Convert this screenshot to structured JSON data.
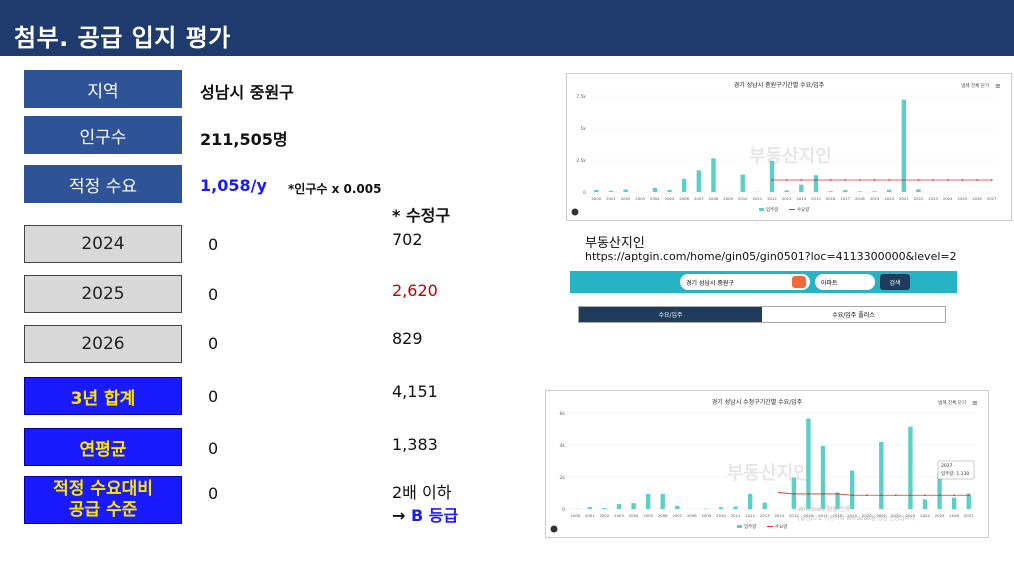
{
  "title": "첨부. 공급 입지 평가",
  "rows": {
    "region": {
      "label": "지역",
      "value": "성남시 중원구"
    },
    "population": {
      "label": "인구수",
      "value": "211,505명"
    },
    "demand": {
      "label": "적정 수요",
      "value": "1,058/y",
      "note": "*인구수 x 0.005"
    },
    "y2024": {
      "label": "2024",
      "value": "0",
      "compare": "702"
    },
    "y2025": {
      "label": "2025",
      "value": "0",
      "compare": "2,620"
    },
    "y2026": {
      "label": "2026",
      "value": "0",
      "compare": "829"
    },
    "total": {
      "label": "3년 합계",
      "value": "0",
      "compare": "4,151"
    },
    "avg": {
      "label": "연평균",
      "value": "0",
      "compare": "1,383"
    },
    "level": {
      "label_line1": "적정 수요대비",
      "label_line2": "공급 수준",
      "value": "0",
      "compare_line1": "2배 이하",
      "compare_line2_prefix": "→ ",
      "compare_line2_grade": "B 등급"
    }
  },
  "compare_header": "* 수정구",
  "source": {
    "name": "부동산지인",
    "url": "https://aptgin.com/home/gin05/gin0501?loc=4113300000&level=2"
  },
  "chart_top": {
    "title": "경기 성남시 중원구기간별 수요/입주",
    "expand_label": "범례 전체 닫기",
    "watermark": "부동산지인",
    "legend": [
      "입주량",
      "수요량"
    ],
    "y_ticks": [
      "7.5k",
      "5k",
      "2.5k",
      "0"
    ]
  },
  "chart_bottom": {
    "title": "경기 성남시 수정구기간별 수요/입주",
    "expand_label": "범례 전체 닫기",
    "watermark": "부동산지인",
    "legend": [
      "입주량",
      "수요량"
    ],
    "y_ticks": [
      "6k",
      "4k",
      "2k",
      "0"
    ],
    "tooltip_year": "2027",
    "tooltip_text": "입주량: 1,130",
    "activation": "Windows 정품 인증",
    "activation2": "[설정]으로 이동하여 Windows를 정품 인증합니다."
  },
  "search": {
    "region_label": "지역",
    "region_value": "경기 성남시 중원구",
    "button": "검색",
    "period_label": "수요/입주",
    "period_value": "아파트",
    "submit": "검색"
  },
  "tabs": [
    "수요/입주",
    "수요/입주 플러스"
  ],
  "chart_data": [
    {
      "type": "bar",
      "title": "경기 성남시 중원구기간별 수요/입주",
      "categories": [
        "2000",
        "2001",
        "2002",
        "2003",
        "2004",
        "2005",
        "2006",
        "2007",
        "2008",
        "2009",
        "2010",
        "2011",
        "2012",
        "2013",
        "2014",
        "2015",
        "2016",
        "2017",
        "2018",
        "2019",
        "2020",
        "2021",
        "2022",
        "2023",
        "2024",
        "2025",
        "2026",
        "2027"
      ],
      "series": [
        {
          "name": "입주량",
          "values": [
            170,
            102,
            205,
            0,
            340,
            174,
            1100,
            1800,
            2800,
            0,
            1450,
            18,
            2600,
            128,
            611,
            1400,
            70,
            156,
            51,
            58,
            184,
            7700,
            230,
            0,
            0,
            0,
            0,
            0
          ]
        },
        {
          "name": "수요량",
          "values": [
            null,
            null,
            null,
            null,
            null,
            null,
            null,
            null,
            null,
            null,
            null,
            null,
            1000,
            1000,
            1000,
            1000,
            1000,
            1000,
            1000,
            1000,
            1000,
            1000,
            1000,
            1000,
            1000,
            1000,
            1000,
            1000
          ]
        }
      ],
      "ylim": [
        0,
        8000
      ]
    },
    {
      "type": "bar",
      "title": "경기 성남시 수정구기간별 수요/입주",
      "categories": [
        "2000",
        "2001",
        "2002",
        "2003",
        "2004",
        "2005",
        "2006",
        "2007",
        "2008",
        "2009",
        "2010",
        "2011",
        "2012",
        "2013",
        "2014",
        "2015",
        "2016",
        "2017",
        "2018",
        "2019",
        "2020",
        "2021",
        "2022",
        "2023",
        "2024",
        "2025",
        "2026",
        "2027"
      ],
      "series": [
        {
          "name": "입주량",
          "values": [
            0,
            137,
            75,
            354,
            427,
            1100,
            1100,
            232,
            0,
            32,
            130,
            181,
            1100,
            463,
            0,
            2300,
            6600,
            4600,
            1200,
            2800,
            0,
            4900,
            0,
            6000,
            702,
            2620,
            829,
            1130
          ]
        },
        {
          "name": "수요량",
          "values": [
            null,
            null,
            null,
            null,
            null,
            null,
            null,
            null,
            null,
            null,
            null,
            null,
            null,
            null,
            1200,
            1100,
            1100,
            1100,
            1100,
            1000,
            1000,
            1000,
            1000,
            1000,
            1000,
            1000,
            1000,
            1000
          ]
        }
      ],
      "ylim": [
        0,
        7000
      ]
    }
  ],
  "colors": {
    "title_bg": "#1f3b6e",
    "navy": "#2e5397",
    "blue_box": "#1a1aff",
    "yellow_text": "#ffe600",
    "red_value": "#c00000",
    "bar": "#5ccfc6",
    "demand_line": "#e03030"
  }
}
